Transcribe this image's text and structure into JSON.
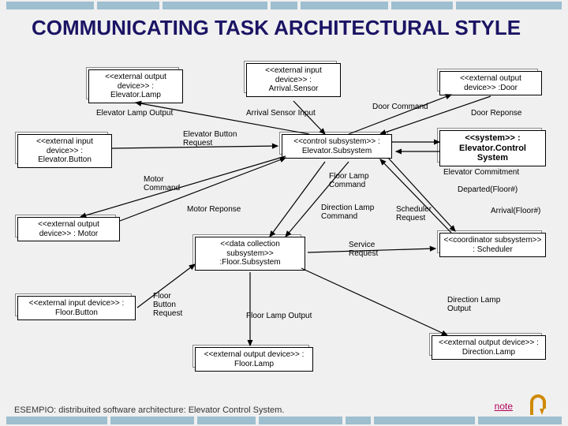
{
  "title": "COMMUNICATING TASK ARCHITECTURAL STYLE",
  "boxes": {
    "elevatorLamp": "<<external output device>>\n: Elevator.Lamp",
    "arrivalSensor": "<<external input device>>\n: Arrival.Sensor",
    "door": "<<external output device>> :Door",
    "elevatorButton": "<<external input device>>\n: Elevator.Button",
    "elevatorSubsystem": "<<control subsystem>>\n: Elevator.Subsystem",
    "elevatorControlSystem": "<<system>>\n: Elevator.Control System",
    "motor": "<<external output device>> : Motor",
    "floorSubsystem": "<<data collection subsystem>>\n:Floor.Subsystem",
    "scheduler": "<<coordinator subsystem>>\n: Scheduler",
    "floorButton": "<<external input device>> : Floor.Button",
    "floorLamp": "<<external output device>> : Floor.Lamp",
    "directionLamp": "<<external output device>>\n: Direction.Lamp"
  },
  "labels": {
    "elevatorLampOutput": "Elevator Lamp Output",
    "arrivalSensorInput": "Arrival Sensor Input",
    "doorCommand": "Door Command",
    "doorResponse": "Door Reponse",
    "elevatorButtonRequest": "Elevator Button\nRequest",
    "motorCommand": "Motor\nCommand",
    "motorResponse": "Motor Reponse",
    "floorLampCommand": "Floor Lamp\nCommand",
    "directionLampCommand": "Direction Lamp\nCommand",
    "schedulerRequest": "Scheduler\nRequest",
    "serviceRequest": "Service\nRequest",
    "elevatorCommitment": "Elevator Commitment",
    "departed": "Departed(Floor#)",
    "arrival": "Arrival(Floor#)",
    "floorButtonRequest": "Floor\nButton\nRequest",
    "floorLampOutput": "Floor Lamp Output",
    "directionLampOutput": "Direction Lamp\nOutput"
  },
  "caption": "ESEMPIO: distribuited software architecture: Elevator Control System.",
  "linkNote": "note"
}
